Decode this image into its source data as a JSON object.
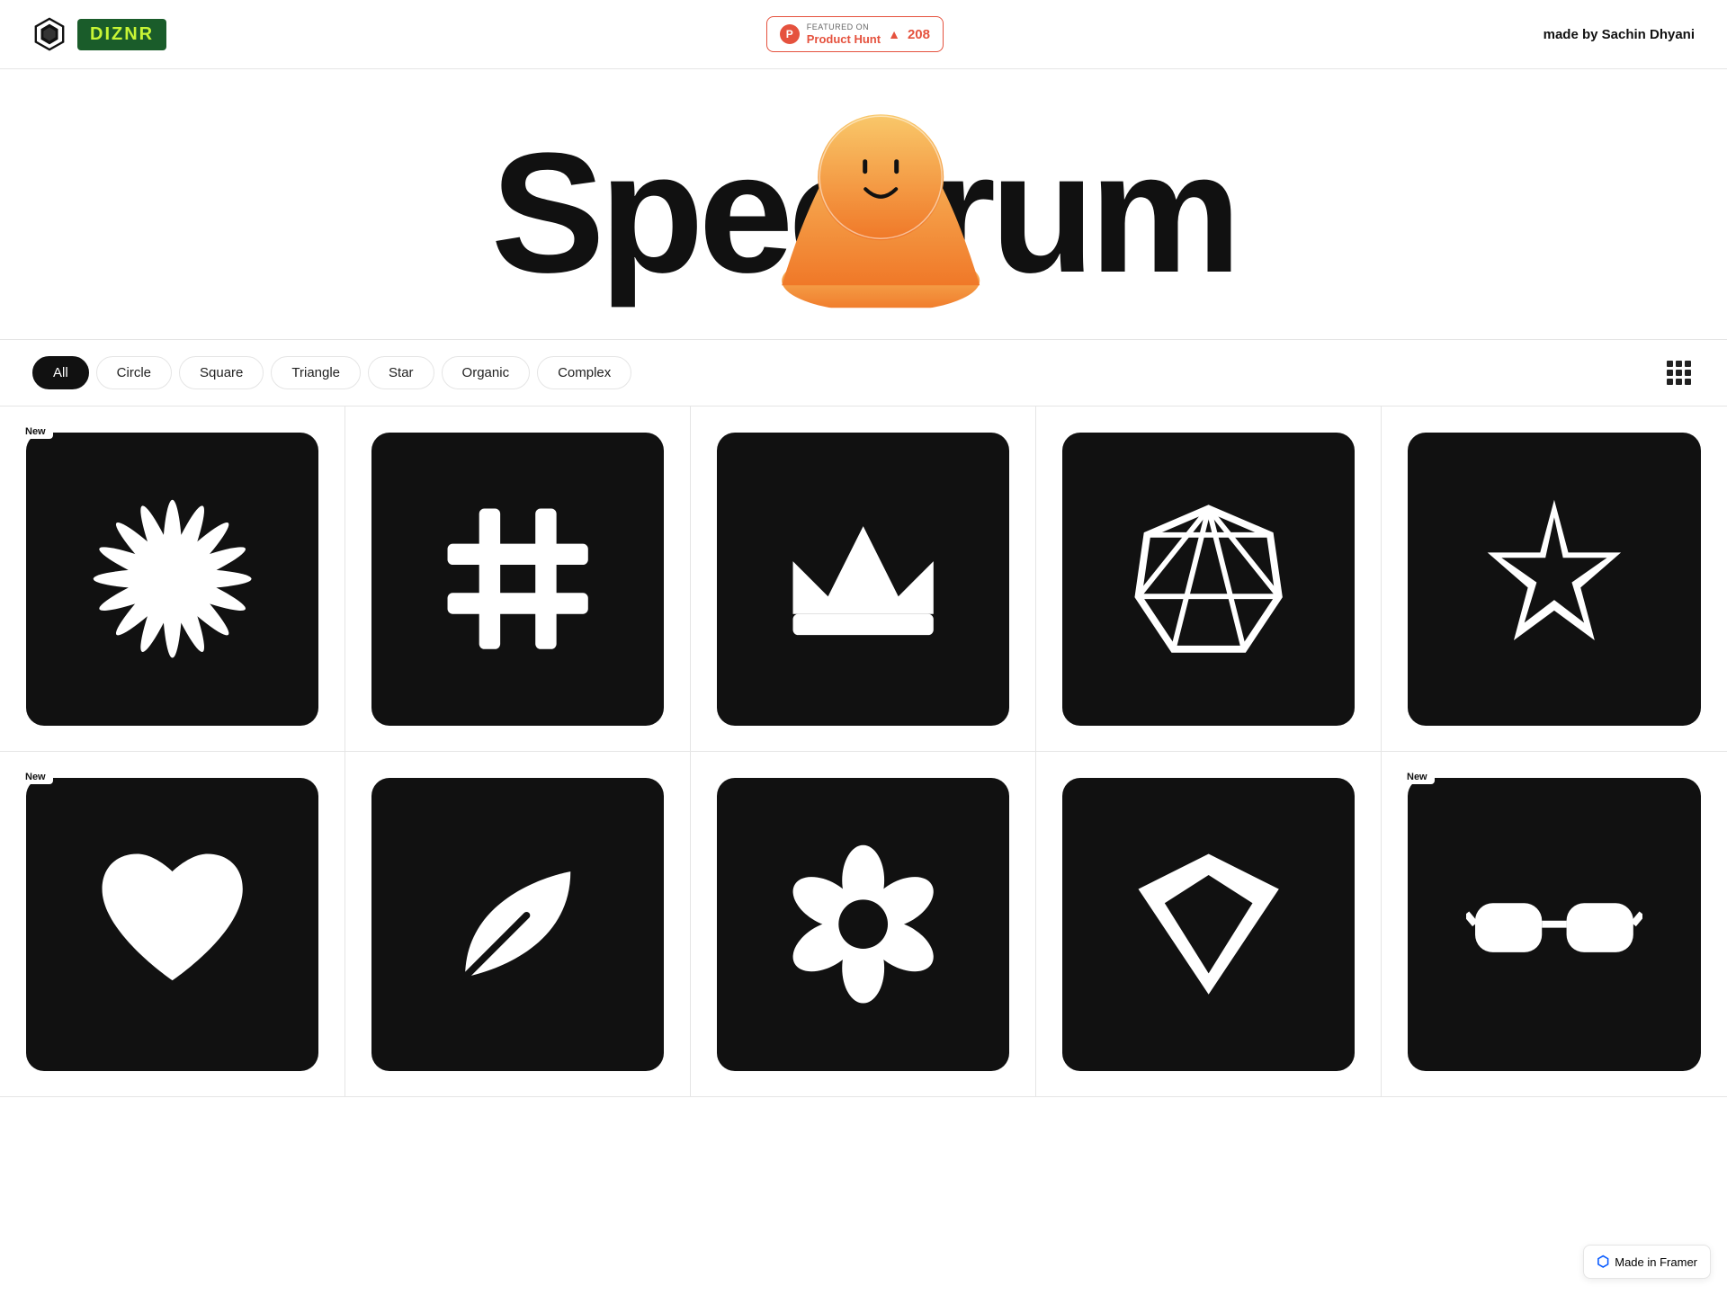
{
  "header": {
    "logo_icon_label": "diznr-hex-icon",
    "logo_wordmark": "DIZNR",
    "product_hunt": {
      "featured_label": "FEATURED ON",
      "name": "Product Hunt",
      "count": "208"
    },
    "made_by_prefix": "made by",
    "made_by_name": "Sachin Dhyani"
  },
  "hero": {
    "title": "Spectrum"
  },
  "filters": {
    "buttons": [
      {
        "label": "All",
        "active": true
      },
      {
        "label": "Circle",
        "active": false
      },
      {
        "label": "Square",
        "active": false
      },
      {
        "label": "Triangle",
        "active": false
      },
      {
        "label": "Star",
        "active": false
      },
      {
        "label": "Organic",
        "active": false
      },
      {
        "label": "Complex",
        "active": false
      }
    ]
  },
  "grid": {
    "cells": [
      {
        "id": 1,
        "new": true,
        "type": "starburst"
      },
      {
        "id": 2,
        "new": false,
        "type": "hashtag"
      },
      {
        "id": 3,
        "new": false,
        "type": "crown"
      },
      {
        "id": 4,
        "new": false,
        "type": "facet"
      },
      {
        "id": 5,
        "new": false,
        "type": "spiky-star"
      },
      {
        "id": 6,
        "new": true,
        "type": "heart"
      },
      {
        "id": 7,
        "new": false,
        "type": "leaf"
      },
      {
        "id": 8,
        "new": false,
        "type": "floral"
      },
      {
        "id": 9,
        "new": false,
        "type": "shield"
      },
      {
        "id": 10,
        "new": true,
        "type": "glasses"
      }
    ]
  },
  "made_in_framer": {
    "label": "Made in Framer"
  }
}
